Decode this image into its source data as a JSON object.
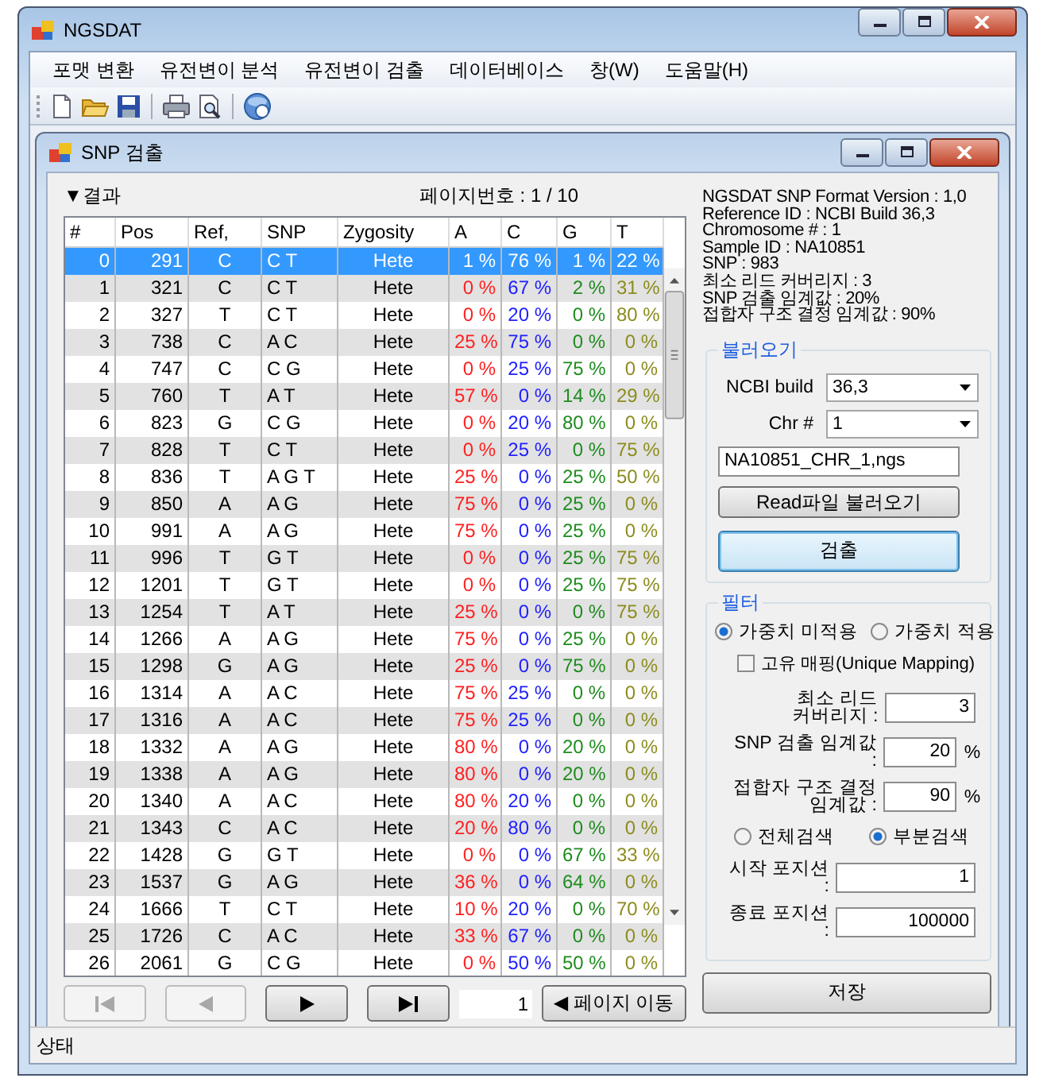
{
  "window": {
    "title": "NGSDAT"
  },
  "menu": [
    {
      "label": "포맷 변환"
    },
    {
      "label": "유전변이 분석"
    },
    {
      "label": "유전변이 검출"
    },
    {
      "label": "데이터베이스"
    },
    {
      "label": "창(W)"
    },
    {
      "label": "도움말(H)"
    }
  ],
  "child_window": {
    "title": "SNP 검출"
  },
  "results": {
    "heading": "▼결과",
    "page_label": "페이지번호 : 1 / 10",
    "columns": [
      {
        "label": "#"
      },
      {
        "label": "Pos"
      },
      {
        "label": "Ref,"
      },
      {
        "label": "SNP"
      },
      {
        "label": "Zygosity"
      },
      {
        "label": "A",
        "color": "#ff2020"
      },
      {
        "label": "C",
        "color": "#2020ff"
      },
      {
        "label": "G",
        "color": "#1e8c1e"
      },
      {
        "label": "T",
        "color": "#8c8c1e"
      }
    ],
    "rows": [
      {
        "cells": [
          "0",
          "291",
          "C",
          "C T",
          "Hete",
          "1 %",
          "76 %",
          "1 %",
          "22 %"
        ],
        "selected": true
      },
      {
        "cells": [
          "1",
          "321",
          "C",
          "C T",
          "Hete",
          "0 %",
          "67 %",
          "2 %",
          "31 %"
        ],
        "selected": false
      },
      {
        "cells": [
          "2",
          "327",
          "T",
          "C T",
          "Hete",
          "0 %",
          "20 %",
          "0 %",
          "80 %"
        ],
        "selected": false
      },
      {
        "cells": [
          "3",
          "738",
          "C",
          "A C",
          "Hete",
          "25 %",
          "75 %",
          "0 %",
          "0 %"
        ],
        "selected": false
      },
      {
        "cells": [
          "4",
          "747",
          "C",
          "C G",
          "Hete",
          "0 %",
          "25 %",
          "75 %",
          "0 %"
        ],
        "selected": false
      },
      {
        "cells": [
          "5",
          "760",
          "T",
          "A T",
          "Hete",
          "57 %",
          "0 %",
          "14 %",
          "29 %"
        ],
        "selected": false
      },
      {
        "cells": [
          "6",
          "823",
          "G",
          "C G",
          "Hete",
          "0 %",
          "20 %",
          "80 %",
          "0 %"
        ],
        "selected": false
      },
      {
        "cells": [
          "7",
          "828",
          "T",
          "C T",
          "Hete",
          "0 %",
          "25 %",
          "0 %",
          "75 %"
        ],
        "selected": false
      },
      {
        "cells": [
          "8",
          "836",
          "T",
          "A G T",
          "Hete",
          "25 %",
          "0 %",
          "25 %",
          "50 %"
        ],
        "selected": false
      },
      {
        "cells": [
          "9",
          "850",
          "A",
          "A G",
          "Hete",
          "75 %",
          "0 %",
          "25 %",
          "0 %"
        ],
        "selected": false
      },
      {
        "cells": [
          "10",
          "991",
          "A",
          "A G",
          "Hete",
          "75 %",
          "0 %",
          "25 %",
          "0 %"
        ],
        "selected": false
      },
      {
        "cells": [
          "11",
          "996",
          "T",
          "G T",
          "Hete",
          "0 %",
          "0 %",
          "25 %",
          "75 %"
        ],
        "selected": false
      },
      {
        "cells": [
          "12",
          "1201",
          "T",
          "G T",
          "Hete",
          "0 %",
          "0 %",
          "25 %",
          "75 %"
        ],
        "selected": false
      },
      {
        "cells": [
          "13",
          "1254",
          "T",
          "A T",
          "Hete",
          "25 %",
          "0 %",
          "0 %",
          "75 %"
        ],
        "selected": false
      },
      {
        "cells": [
          "14",
          "1266",
          "A",
          "A G",
          "Hete",
          "75 %",
          "0 %",
          "25 %",
          "0 %"
        ],
        "selected": false
      },
      {
        "cells": [
          "15",
          "1298",
          "G",
          "A G",
          "Hete",
          "25 %",
          "0 %",
          "75 %",
          "0 %"
        ],
        "selected": false
      },
      {
        "cells": [
          "16",
          "1314",
          "A",
          "A C",
          "Hete",
          "75 %",
          "25 %",
          "0 %",
          "0 %"
        ],
        "selected": false
      },
      {
        "cells": [
          "17",
          "1316",
          "A",
          "A C",
          "Hete",
          "75 %",
          "25 %",
          "0 %",
          "0 %"
        ],
        "selected": false
      },
      {
        "cells": [
          "18",
          "1332",
          "A",
          "A G",
          "Hete",
          "80 %",
          "0 %",
          "20 %",
          "0 %"
        ],
        "selected": false
      },
      {
        "cells": [
          "19",
          "1338",
          "A",
          "A G",
          "Hete",
          "80 %",
          "0 %",
          "20 %",
          "0 %"
        ],
        "selected": false
      },
      {
        "cells": [
          "20",
          "1340",
          "A",
          "A C",
          "Hete",
          "80 %",
          "20 %",
          "0 %",
          "0 %"
        ],
        "selected": false
      },
      {
        "cells": [
          "21",
          "1343",
          "C",
          "A C",
          "Hete",
          "20 %",
          "80 %",
          "0 %",
          "0 %"
        ],
        "selected": false
      },
      {
        "cells": [
          "22",
          "1428",
          "G",
          "G T",
          "Hete",
          "0 %",
          "0 %",
          "67 %",
          "33 %"
        ],
        "selected": false
      },
      {
        "cells": [
          "23",
          "1537",
          "G",
          "A G",
          "Hete",
          "36 %",
          "0 %",
          "64 %",
          "0 %"
        ],
        "selected": false
      },
      {
        "cells": [
          "24",
          "1666",
          "T",
          "C T",
          "Hete",
          "10 %",
          "20 %",
          "0 %",
          "70 %"
        ],
        "selected": false
      },
      {
        "cells": [
          "25",
          "1726",
          "C",
          "A C",
          "Hete",
          "33 %",
          "67 %",
          "0 %",
          "0 %"
        ],
        "selected": false
      },
      {
        "cells": [
          "26",
          "2061",
          "G",
          "C G",
          "Hete",
          "0 %",
          "50 %",
          "50 %",
          "0 %"
        ],
        "selected": false
      }
    ]
  },
  "pager": {
    "buttons": [
      {
        "kind": "first",
        "disabled": true
      },
      {
        "kind": "prev",
        "disabled": true
      },
      {
        "kind": "next",
        "disabled": false
      },
      {
        "kind": "last",
        "disabled": false
      }
    ],
    "page_value": "1",
    "go_button": "◀ 페이지 이동"
  },
  "info": [
    "NGSDAT SNP Format Version : 1,0",
    "Reference ID : NCBI Build 36,3",
    "Chromosome # : 1",
    "Sample ID : NA10851",
    "SNP : 983",
    "최소 리드 커버리지 : 3",
    "SNP 검출 임계값  : 20%",
    "접합자 구조 결정 임계값 : 90%"
  ],
  "load": {
    "legend": "불러오기",
    "build_label": "NCBI build",
    "build_value": "36,3",
    "chr_label": "Chr #",
    "chr_value": "1",
    "file_value": "NA10851_CHR_1,ngs",
    "read_button": "Read파일 불러오기",
    "detect_button": {
      "label": "검출",
      "focused": true
    }
  },
  "filter": {
    "legend": "필터",
    "weight_options": [
      {
        "label": "가중치 미적용",
        "selected": true
      },
      {
        "label": "가중치 적용",
        "selected": false
      }
    ],
    "unique_mapping": {
      "label": "고유 매핑(Unique Mapping)",
      "checked": false
    },
    "fields": [
      {
        "label": "최소 리드 커버리지 :",
        "value": "3"
      },
      {
        "label": "SNP 검출 임계값 :",
        "value": "20",
        "unit": "%"
      },
      {
        "label": "접합자 구조 결정 임계값 :",
        "value": "90",
        "unit": "%"
      }
    ],
    "search_options": [
      {
        "label": "전체검색",
        "selected": false
      },
      {
        "label": "부분검색",
        "selected": true
      }
    ],
    "positions": [
      {
        "label": "시작 포지션 :",
        "value": "1"
      },
      {
        "label": "종료 포지션 :",
        "value": "100000"
      }
    ]
  },
  "save_button": "저장",
  "status_bar": "상태"
}
